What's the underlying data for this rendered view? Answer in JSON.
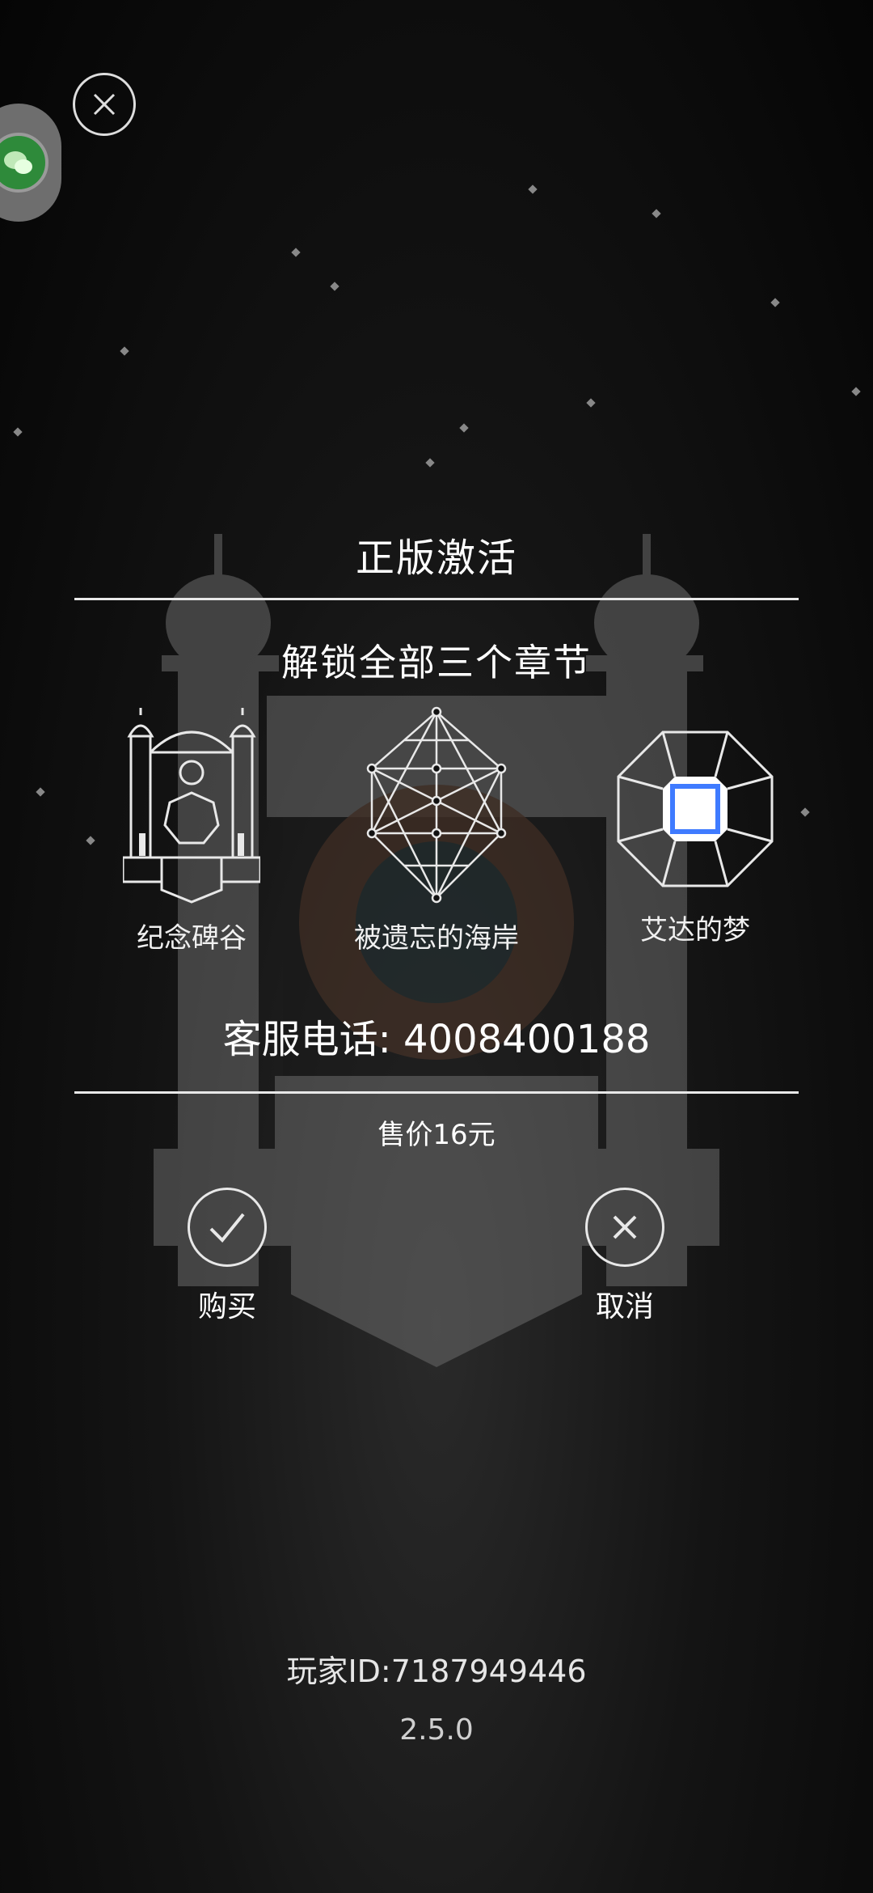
{
  "dialog": {
    "title": "正版激活",
    "subtitle": "解锁全部三个章节",
    "chapters": [
      {
        "label": "纪念碑谷",
        "icon": "temple-icon"
      },
      {
        "label": "被遗忘的海岸",
        "icon": "sacred-geometry-icon"
      },
      {
        "label": "艾达的梦",
        "icon": "octagon-square-icon"
      }
    ],
    "customer_service": "客服电话: 4008400188",
    "price": "售价16元",
    "buy_label": "购买",
    "cancel_label": "取消"
  },
  "footer": {
    "player_id": "玩家ID:7187949446",
    "version": "2.5.0"
  },
  "colors": {
    "background": "#050505",
    "text": "#ffffff",
    "accent_blue": "#3f7bff",
    "wechat_green": "#2e8a3a"
  }
}
